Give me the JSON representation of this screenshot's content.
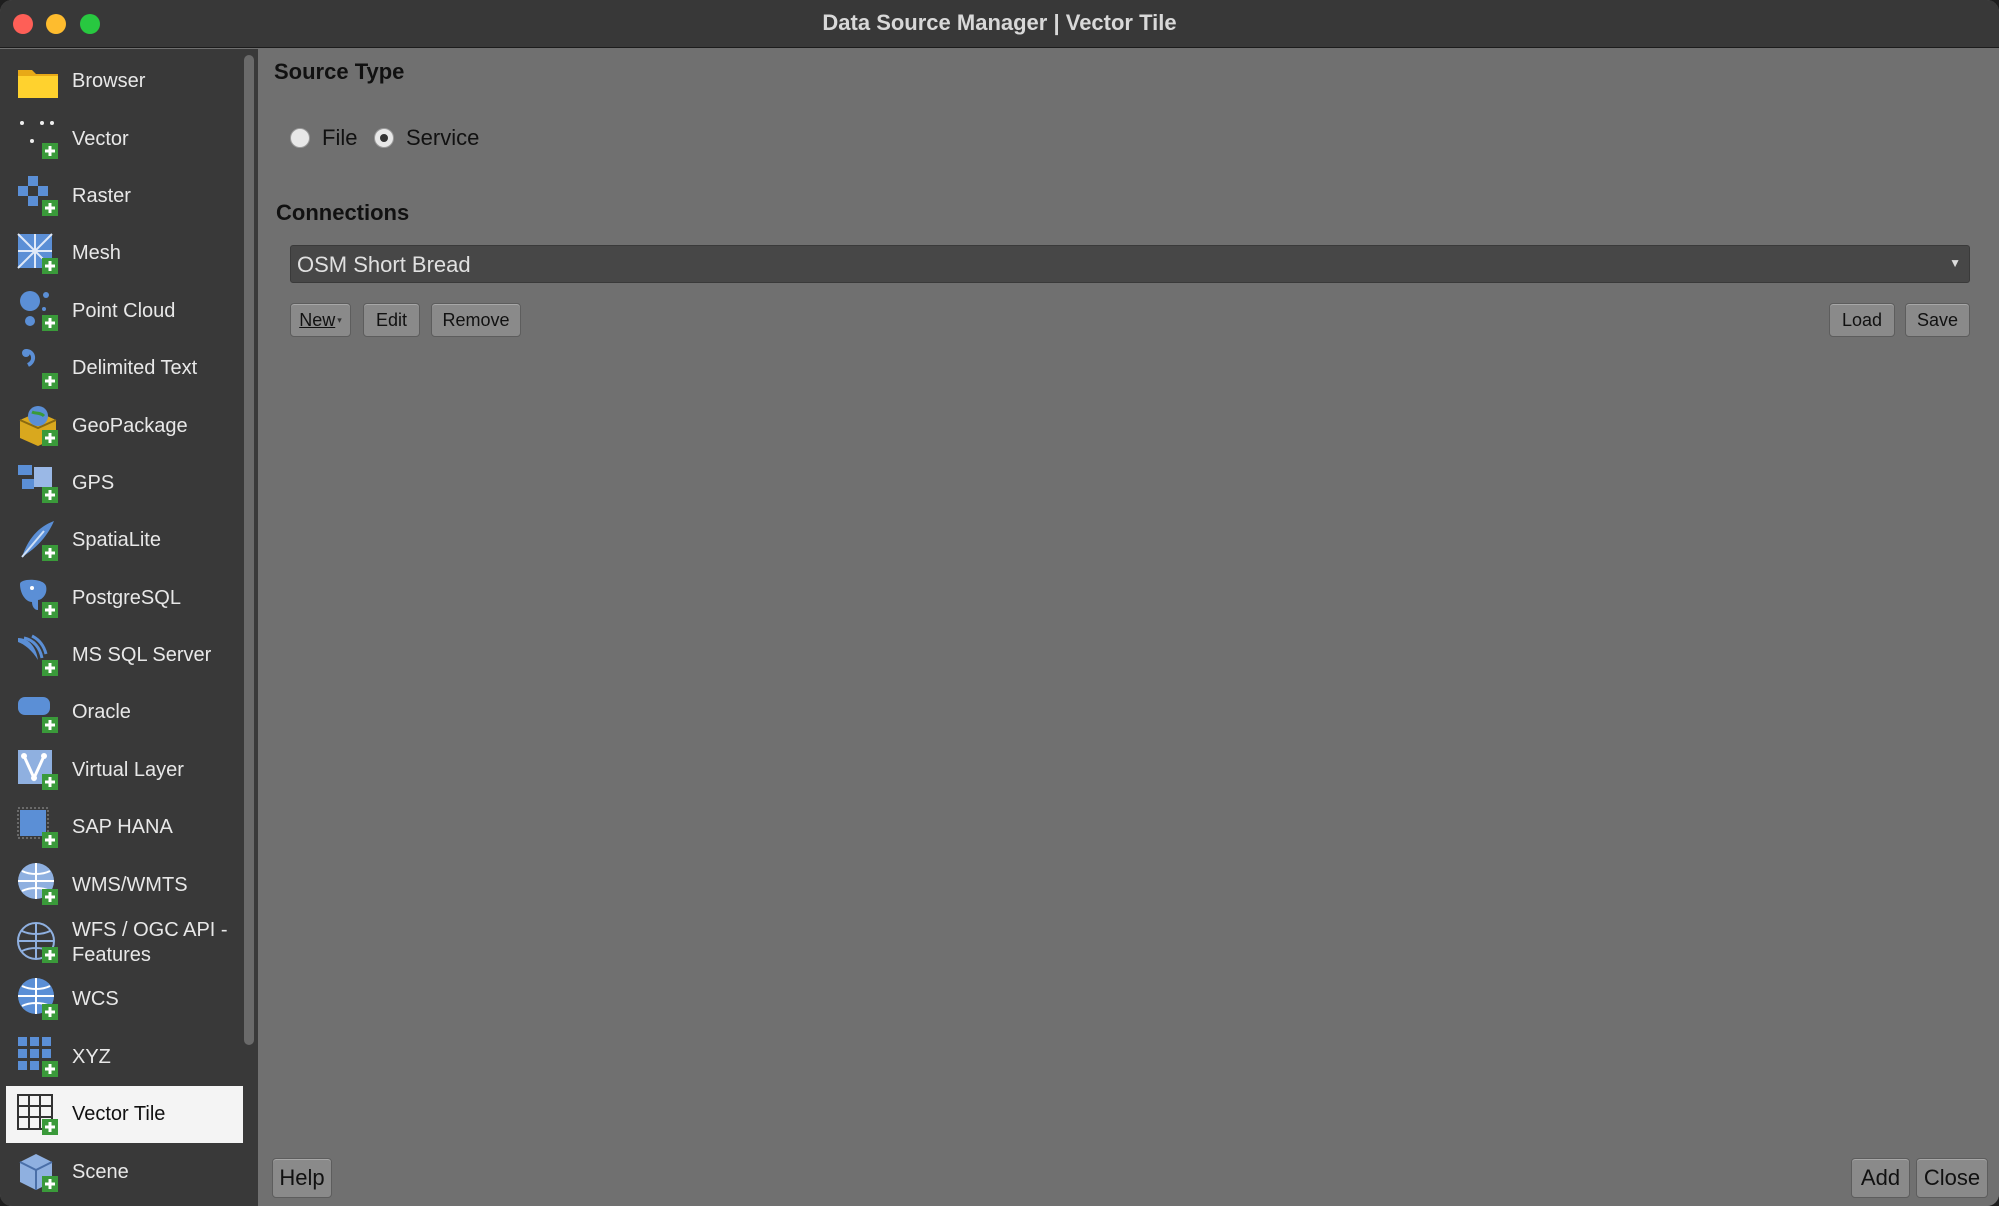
{
  "window": {
    "title": "Data Source Manager | Vector Tile"
  },
  "sidebar": {
    "items": [
      {
        "label": "Browser",
        "icon": "folder-icon"
      },
      {
        "label": "Vector",
        "icon": "vector-icon"
      },
      {
        "label": "Raster",
        "icon": "raster-icon"
      },
      {
        "label": "Mesh",
        "icon": "mesh-icon"
      },
      {
        "label": "Point Cloud",
        "icon": "point-cloud-icon"
      },
      {
        "label": "Delimited Text",
        "icon": "delimited-text-icon"
      },
      {
        "label": "GeoPackage",
        "icon": "geopackage-icon"
      },
      {
        "label": "GPS",
        "icon": "gps-icon"
      },
      {
        "label": "SpatiaLite",
        "icon": "spatialite-icon"
      },
      {
        "label": "PostgreSQL",
        "icon": "postgresql-icon"
      },
      {
        "label": "MS SQL Server",
        "icon": "mssql-icon"
      },
      {
        "label": "Oracle",
        "icon": "oracle-icon"
      },
      {
        "label": "Virtual Layer",
        "icon": "virtual-layer-icon"
      },
      {
        "label": "SAP HANA",
        "icon": "sap-hana-icon"
      },
      {
        "label": "WMS/WMTS",
        "icon": "wms-icon"
      },
      {
        "label": "WFS / OGC API - Features",
        "icon": "wfs-icon"
      },
      {
        "label": "WCS",
        "icon": "wcs-icon"
      },
      {
        "label": "XYZ",
        "icon": "xyz-icon"
      },
      {
        "label": "Vector Tile",
        "icon": "vector-tile-icon",
        "selected": true
      },
      {
        "label": "Scene",
        "icon": "scene-icon"
      }
    ]
  },
  "main": {
    "source_type_title": "Source Type",
    "radio_file": "File",
    "radio_service": "Service",
    "selected_source_type": "Service",
    "connections_title": "Connections",
    "connection_selected": "OSM Short Bread",
    "buttons": {
      "new": "New",
      "edit": "Edit",
      "remove": "Remove",
      "load": "Load",
      "save": "Save"
    }
  },
  "footer": {
    "help": "Help",
    "add": "Add",
    "close": "Close"
  }
}
